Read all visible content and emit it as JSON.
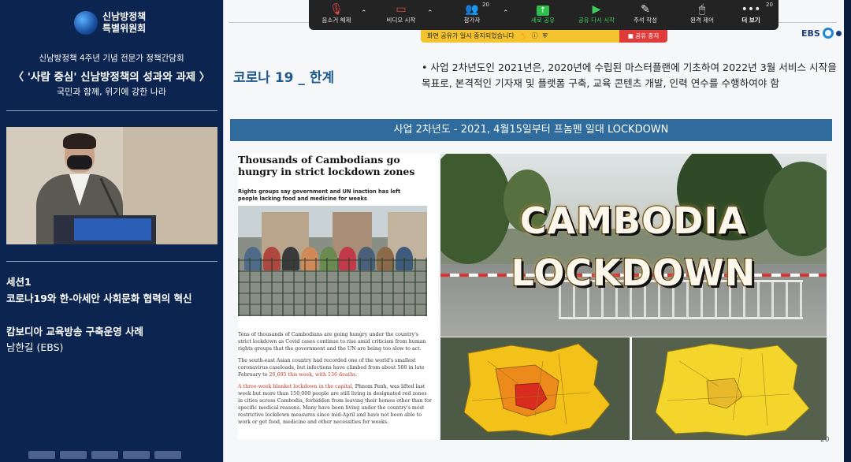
{
  "left_panel": {
    "logo_line1": "신남방정책",
    "logo_line2": "특별위원회",
    "event_sub": "신남방정책 4주년 기념 전문가 정책간담회",
    "event_title": "〈 '사람 중심' 신남방정책의 성과와 과제 〉",
    "event_slogan": "국민과 함께, 위기에 강한 나라",
    "session_label": "세션1",
    "session_title": "코로나19와 한-아세안 사회문화 협력의 혁신",
    "talk_title": "캄보디아 교육방송 구축운영 사례",
    "presenter": "남한길 (EBS)"
  },
  "toolbar": {
    "items": [
      {
        "label": "음소거 해제",
        "icon": "mic-muted-icon"
      },
      {
        "label": "비디오 시작",
        "icon": "video-off-icon"
      },
      {
        "label": "참가자",
        "icon": "participants-icon",
        "count": "20"
      },
      {
        "label": "새로 공유",
        "icon": "share-screen-icon"
      },
      {
        "label": "공유 다시 시작",
        "icon": "resume-share-icon"
      },
      {
        "label": "주석 작성",
        "icon": "annotate-icon"
      },
      {
        "label": "원격 제어",
        "icon": "remote-control-icon"
      },
      {
        "label": "더 보기",
        "icon": "more-icon",
        "count": "20"
      }
    ]
  },
  "share_bar": {
    "message": "화면 공유가 일시 중지되었습니다",
    "stop_label": "■ 공유 중지"
  },
  "slide": {
    "brand": "EBS",
    "heading": "코로나 19 _ 한계",
    "bullet": "• 사업 2차년도인 2021년은, 2020년에 수립된 마스터플랜에 기초하여 2022년 3월 서비스 시작을 목표로, 본격적인 기자재 및 플랫폼 구축, 교육 콘텐츠 개발, 인력 연수를 수행하여야 함",
    "banner": "사업 2차년도 - 2021, 4월15일부터 프놈펜 일대 LOCKDOWN",
    "article": {
      "headline": "Thousands of Cambodians go hungry in strict lockdown zones",
      "dek": "Rights groups say government and UN inaction has left people lacking food and medicine for weeks",
      "body1": "Tens of thousands of Cambodians are going hungry under the country's strict lockdown as Covid cases continue to rise amid criticism from human rights groups that the government and the UN are being too slow to act.",
      "body2a": "The south-east Asian country had recorded one of the world's smallest coronavirus caseloads, but infections have climbed from about 500 in late February to ",
      "body2_link": "20,695 this week, with 136 deaths.",
      "body3_link": "A three-week blanket lockdown in the capital,",
      "body3": " Phnom Penh, was lifted last week but more than 150,000 people are still living in designated red zones in cities across Cambodia, forbidden from leaving their homes other than for specific medical reasons. Many have been living under the country's most restrictive lockdown measures since mid-April and have not been able to work or get food, medicine and other necessities for weeks."
    },
    "photo_text_1": "CAMBODIA",
    "photo_text_2": "LOCKDOWN",
    "page_number": "20"
  }
}
